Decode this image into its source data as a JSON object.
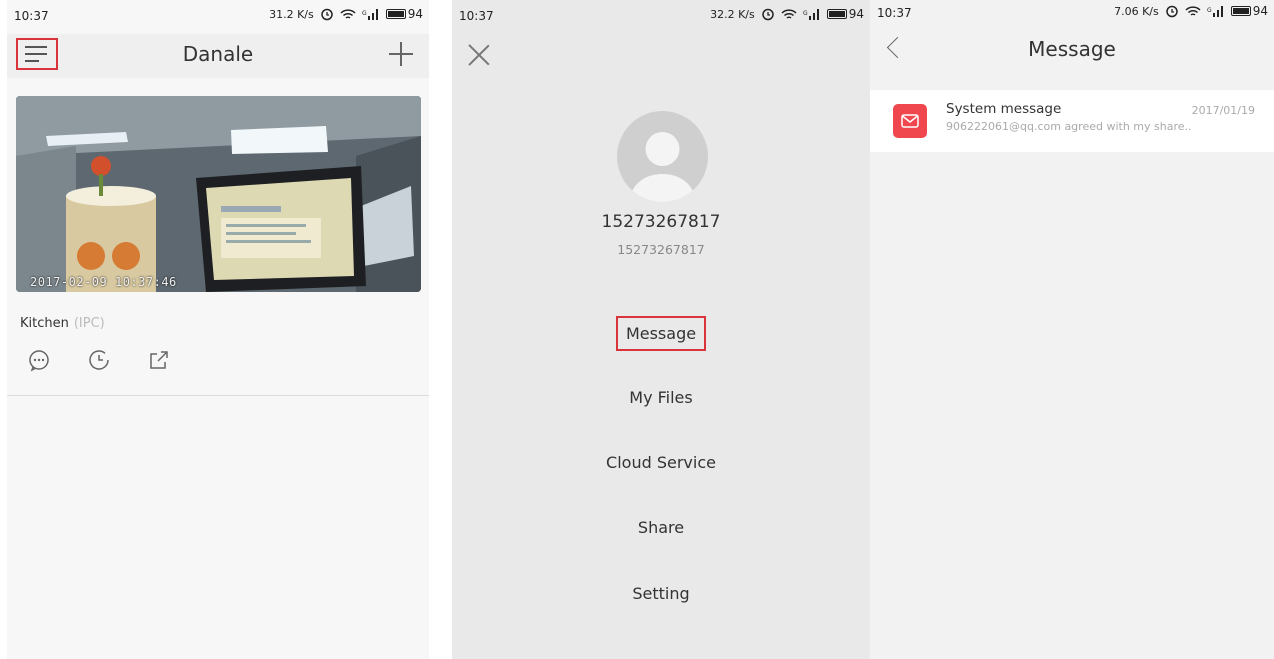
{
  "screen1": {
    "status": {
      "time": "10:37",
      "speed": "31.2 K/s",
      "battery": "94"
    },
    "app_title": "Danale",
    "camera": {
      "timestamp": "2017-02-09 10:37:46",
      "name": "Kitchen",
      "type": "(IPC)"
    },
    "icons": [
      "menu-icon",
      "plus-icon",
      "message-icon",
      "playback-clock-icon",
      "share-icon"
    ]
  },
  "screen2": {
    "status": {
      "time": "10:37",
      "speed": "32.2 K/s",
      "battery": "94"
    },
    "user": {
      "name": "15273267817",
      "id": "15273267817"
    },
    "menu": [
      {
        "label": "Message",
        "highlighted": true
      },
      {
        "label": "My Files"
      },
      {
        "label": "Cloud Service"
      },
      {
        "label": "Share"
      },
      {
        "label": "Setting"
      }
    ]
  },
  "screen3": {
    "status": {
      "time": "10:37",
      "speed": "7.06 K/s",
      "battery": "94"
    },
    "title": "Message",
    "messages": [
      {
        "title": "System message",
        "date": "2017/01/19",
        "preview": "906222061@qq.com agreed with my share.."
      }
    ]
  },
  "colors": {
    "highlight": "#d9343b",
    "message_icon_bg": "#f0474f"
  }
}
